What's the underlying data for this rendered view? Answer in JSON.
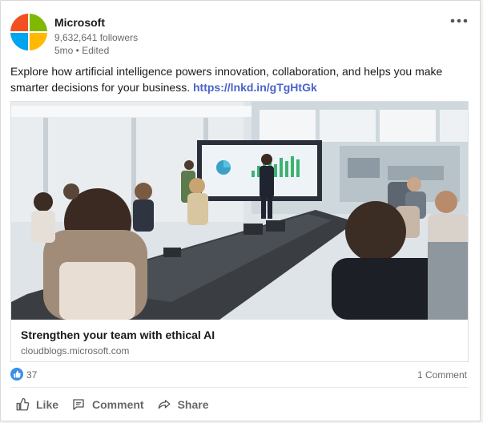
{
  "post": {
    "author": {
      "name": "Microsoft",
      "followers": "9,632,641 followers",
      "time": "5mo • Edited",
      "logo_colors": [
        "#f25022",
        "#7fba00",
        "#00a4ef",
        "#ffb900"
      ]
    },
    "more_icon": "more-horizontal-icon",
    "text": "Explore how artificial intelligence powers innovation, collaboration, and helps you make smarter decisions for your business.",
    "link_text": "https://lnkd.in/gTgHtGk",
    "article": {
      "title": "Strengthen your team with ethical AI",
      "source": "cloudblogs.microsoft.com",
      "image_icon": "conference-room-photo"
    },
    "social": {
      "reactions": "37",
      "comments": "1 Comment"
    },
    "actions": [
      {
        "label": "Like",
        "icon": "thumbs-up-icon"
      },
      {
        "label": "Comment",
        "icon": "comment-icon"
      },
      {
        "label": "Share",
        "icon": "share-icon"
      }
    ]
  },
  "colors": {
    "link": "#4b63c8",
    "like_badge": "#378fe9"
  }
}
